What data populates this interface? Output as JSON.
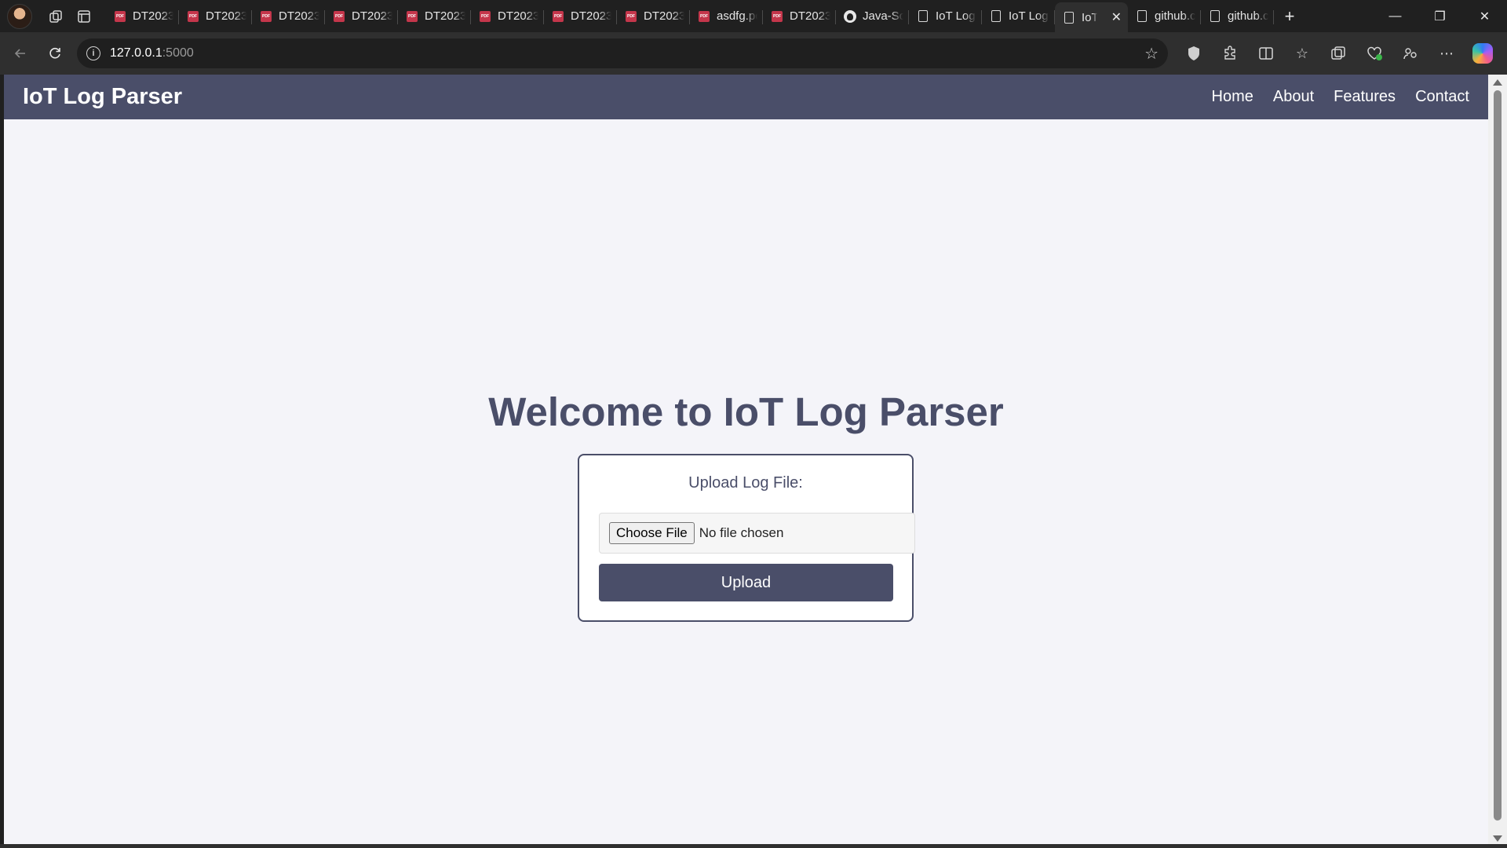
{
  "browser": {
    "tabs": [
      {
        "title": "DT2023",
        "icon": "pdf-icon"
      },
      {
        "title": "DT2023",
        "icon": "pdf-icon"
      },
      {
        "title": "DT2023",
        "icon": "pdf-icon"
      },
      {
        "title": "DT2023",
        "icon": "pdf-icon"
      },
      {
        "title": "DT2023",
        "icon": "pdf-icon"
      },
      {
        "title": "DT2023",
        "icon": "pdf-icon"
      },
      {
        "title": "DT2023",
        "icon": "pdf-icon"
      },
      {
        "title": "DT2023",
        "icon": "pdf-icon"
      },
      {
        "title": "asdfg.pdf",
        "icon": "pdf-icon"
      },
      {
        "title": "DT2023",
        "icon": "pdf-icon"
      },
      {
        "title": "Java-So",
        "icon": "github-icon"
      },
      {
        "title": "IoT Log",
        "icon": "document-icon"
      },
      {
        "title": "IoT Log",
        "icon": "document-icon"
      },
      {
        "title": "IoT",
        "icon": "document-icon",
        "active": true
      },
      {
        "title": "github.c",
        "icon": "document-icon"
      },
      {
        "title": "github.c",
        "icon": "document-icon"
      }
    ],
    "address": {
      "host": "127.0.0.1",
      "port": ":5000"
    }
  },
  "navbar": {
    "brand": "IoT Log Parser",
    "links": [
      "Home",
      "About",
      "Features",
      "Contact"
    ]
  },
  "main": {
    "heading": "Welcome to IoT Log Parser",
    "upload_label": "Upload Log File:",
    "choose_file_label": "Choose File",
    "file_status": "No file chosen",
    "upload_button": "Upload"
  },
  "colors": {
    "navbar_bg": "#4a4e69",
    "page_bg": "#f4f4f9",
    "accent": "#4a4e69"
  }
}
